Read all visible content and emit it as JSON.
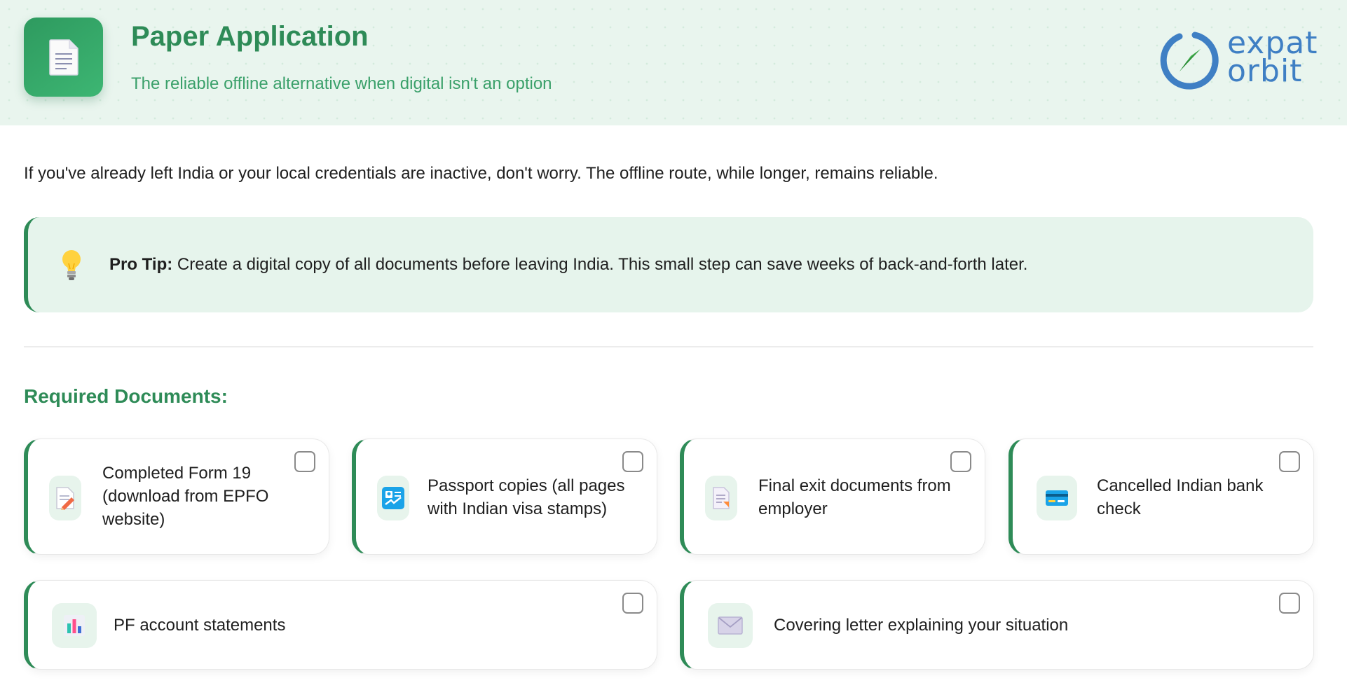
{
  "header": {
    "title": "Paper Application",
    "subtitle": "The reliable offline alternative when digital isn't an option",
    "app_icon": "document-icon",
    "logo": {
      "line1": "expat",
      "line2": "orbit",
      "icon": "orbit-arrow-icon"
    }
  },
  "intro": "If you've already left India or your local credentials are inactive, don't worry. The offline route, while longer, remains reliable.",
  "tip": {
    "icon": "lightbulb-icon",
    "label": "Pro Tip:",
    "text": " Create a digital copy of all documents before leaving India. This small step can save weeks of back-and-forth later."
  },
  "documents": {
    "title": "Required Documents:",
    "items": [
      {
        "label": "Completed Form 19 (download from EPFO website)",
        "icon": "form-pencil-icon",
        "checked": false
      },
      {
        "label": "Passport copies (all pages with Indian visa stamps)",
        "icon": "passport-icon",
        "checked": false
      },
      {
        "label": "Final exit documents from employer",
        "icon": "exit-document-icon",
        "checked": false
      },
      {
        "label": "Cancelled Indian bank check",
        "icon": "bank-card-icon",
        "checked": false
      },
      {
        "label": "PF account statements",
        "icon": "bar-chart-icon",
        "checked": false
      },
      {
        "label": "Covering letter explaining your situation",
        "icon": "envelope-icon",
        "checked": false
      }
    ]
  },
  "colors": {
    "accent": "#2e8b57",
    "header_bg": "#e9f5ee",
    "tip_bg": "#e6f4ec",
    "logo_blue": "#3f7fc4"
  }
}
